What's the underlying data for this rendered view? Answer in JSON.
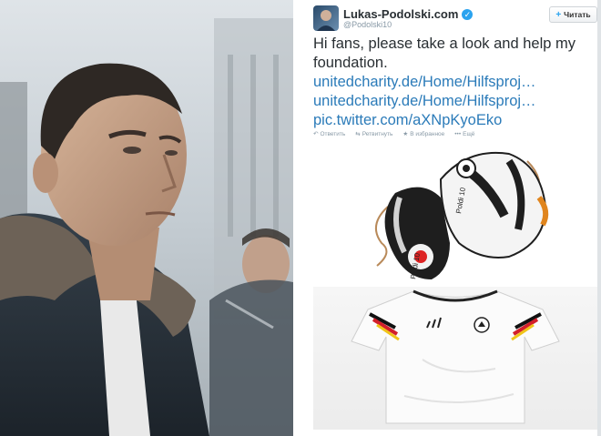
{
  "tweet": {
    "display_name": "Lukas-Podolski.com",
    "handle": "@Podolski10",
    "follow_label": "Читать",
    "text_lines": [
      "Hi fans, please take a look and help my",
      "foundation."
    ],
    "links": [
      "unitedcharity.de/Home/Hilfsproj…",
      "unitedcharity.de/Home/Hilfsproj…",
      "pic.twitter.com/aXNpKyoEko"
    ],
    "actions": {
      "reply": "Ответить",
      "retweet": "Ретвитнуть",
      "favorite": "В избранное",
      "more": "Ещё"
    }
  },
  "media": {
    "boot_text": "Poldi 10"
  },
  "colors": {
    "link": "#2b7bb9",
    "verified": "#2aa3ef",
    "text": "#292f33",
    "muted": "#8899a6"
  }
}
